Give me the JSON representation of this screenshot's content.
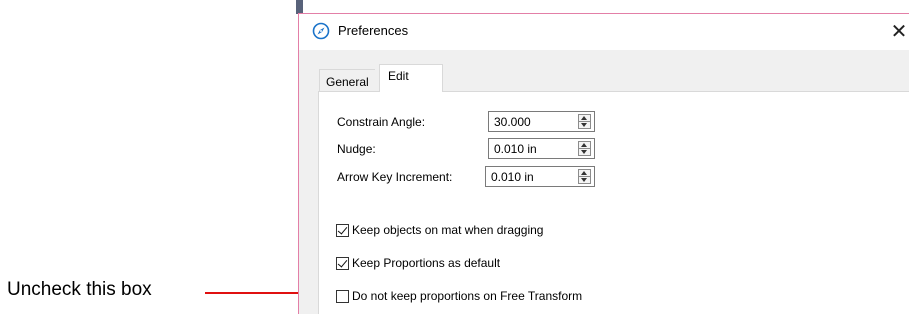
{
  "annotation": {
    "text": "Uncheck this box",
    "arrow_color": "#e01010"
  },
  "dialog": {
    "title": "Preferences",
    "app_icon": "compass-icon",
    "close_glyph": "✕",
    "tabs": [
      {
        "label": "General",
        "active": false
      },
      {
        "label": "Edit",
        "active": true
      }
    ],
    "fields": [
      {
        "label": "Constrain Angle:",
        "value": "30.000"
      },
      {
        "label": "Nudge:",
        "value": "0.010 in"
      },
      {
        "label": "Arrow Key Increment:",
        "value": "0.010 in"
      }
    ],
    "checkboxes": [
      {
        "label": "Keep objects on mat when dragging",
        "checked": true
      },
      {
        "label": "Keep Proportions as default",
        "checked": true
      },
      {
        "label": "Do not keep proportions on Free Transform",
        "checked": false
      }
    ]
  },
  "colors": {
    "window_border": "#e37fa7",
    "icon_blue": "#1a73c9"
  }
}
